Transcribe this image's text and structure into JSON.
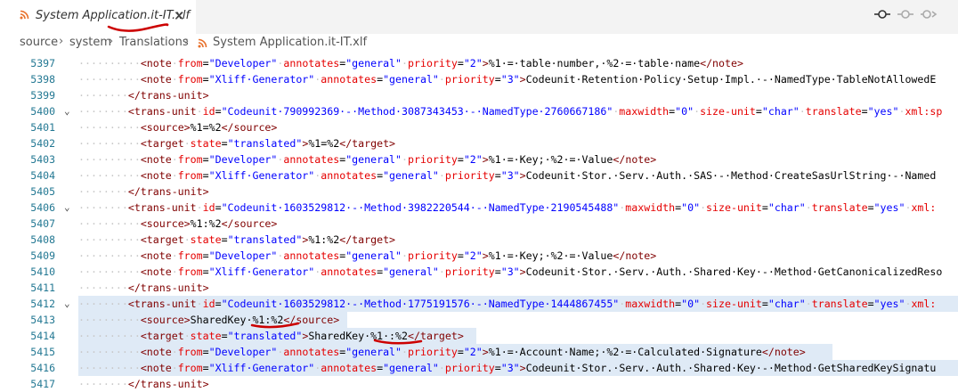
{
  "tab": {
    "title": "System Application.it-IT.xlf",
    "icon": "rss-icon",
    "close": "✕"
  },
  "breadcrumb": {
    "items": [
      "source",
      "system",
      "Translations",
      "System Application.it-IT.xlf"
    ],
    "separator": "›"
  },
  "editor_actions": {
    "icons": [
      "git-commit-icon",
      "git-compare-icon",
      "git-next-icon"
    ]
  },
  "colors": {
    "tag": "#800000",
    "attr": "#e50000",
    "value": "#0000ff",
    "line_number": "#237893",
    "selection": "#dfeaf6",
    "annotation": "#cc0000"
  },
  "lines": [
    {
      "n": "5397",
      "fold": "",
      "code": [
        [
          "ws",
          "··········"
        ],
        [
          "tg",
          "<note"
        ],
        [
          "ws",
          "·"
        ],
        [
          "at",
          "from"
        ],
        [
          "tx",
          "="
        ],
        [
          "av",
          "\"Developer\""
        ],
        [
          "ws",
          "·"
        ],
        [
          "at",
          "annotates"
        ],
        [
          "tx",
          "="
        ],
        [
          "av",
          "\"general\""
        ],
        [
          "ws",
          "·"
        ],
        [
          "at",
          "priority"
        ],
        [
          "tx",
          "="
        ],
        [
          "av",
          "\"2\""
        ],
        [
          "tg",
          ">"
        ],
        [
          "tx",
          "%1·=·table·number,·%2·=·table·name"
        ],
        [
          "tg",
          "</note>"
        ]
      ]
    },
    {
      "n": "5398",
      "fold": "",
      "code": [
        [
          "ws",
          "··········"
        ],
        [
          "tg",
          "<note"
        ],
        [
          "ws",
          "·"
        ],
        [
          "at",
          "from"
        ],
        [
          "tx",
          "="
        ],
        [
          "av",
          "\"Xliff·Generator\""
        ],
        [
          "ws",
          "·"
        ],
        [
          "at",
          "annotates"
        ],
        [
          "tx",
          "="
        ],
        [
          "av",
          "\"general\""
        ],
        [
          "ws",
          "·"
        ],
        [
          "at",
          "priority"
        ],
        [
          "tx",
          "="
        ],
        [
          "av",
          "\"3\""
        ],
        [
          "tg",
          ">"
        ],
        [
          "tx",
          "Codeunit·Retention·Policy·Setup·Impl.·-·NamedType·TableNotAllowedE"
        ]
      ]
    },
    {
      "n": "5399",
      "fold": "",
      "code": [
        [
          "ws",
          "········"
        ],
        [
          "tg",
          "</trans-unit>"
        ]
      ]
    },
    {
      "n": "5400",
      "fold": "⌄",
      "code": [
        [
          "ws",
          "········"
        ],
        [
          "tg",
          "<trans-unit"
        ],
        [
          "ws",
          "·"
        ],
        [
          "at",
          "id"
        ],
        [
          "tx",
          "="
        ],
        [
          "av",
          "\"Codeunit·790992369·-·Method·3087343453·-·NamedType·2760667186\""
        ],
        [
          "ws",
          "·"
        ],
        [
          "at",
          "maxwidth"
        ],
        [
          "tx",
          "="
        ],
        [
          "av",
          "\"0\""
        ],
        [
          "ws",
          "·"
        ],
        [
          "at",
          "size-unit"
        ],
        [
          "tx",
          "="
        ],
        [
          "av",
          "\"char\""
        ],
        [
          "ws",
          "·"
        ],
        [
          "at",
          "translate"
        ],
        [
          "tx",
          "="
        ],
        [
          "av",
          "\"yes\""
        ],
        [
          "ws",
          "·"
        ],
        [
          "at",
          "xml:sp"
        ]
      ]
    },
    {
      "n": "5401",
      "fold": "",
      "code": [
        [
          "ws",
          "··········"
        ],
        [
          "tg",
          "<source>"
        ],
        [
          "tx",
          "%1=%2"
        ],
        [
          "tg",
          "</source>"
        ]
      ]
    },
    {
      "n": "5402",
      "fold": "",
      "code": [
        [
          "ws",
          "··········"
        ],
        [
          "tg",
          "<target"
        ],
        [
          "ws",
          "·"
        ],
        [
          "at",
          "state"
        ],
        [
          "tx",
          "="
        ],
        [
          "av",
          "\"translated\""
        ],
        [
          "tg",
          ">"
        ],
        [
          "tx",
          "%1=%2"
        ],
        [
          "tg",
          "</target>"
        ]
      ]
    },
    {
      "n": "5403",
      "fold": "",
      "code": [
        [
          "ws",
          "··········"
        ],
        [
          "tg",
          "<note"
        ],
        [
          "ws",
          "·"
        ],
        [
          "at",
          "from"
        ],
        [
          "tx",
          "="
        ],
        [
          "av",
          "\"Developer\""
        ],
        [
          "ws",
          "·"
        ],
        [
          "at",
          "annotates"
        ],
        [
          "tx",
          "="
        ],
        [
          "av",
          "\"general\""
        ],
        [
          "ws",
          "·"
        ],
        [
          "at",
          "priority"
        ],
        [
          "tx",
          "="
        ],
        [
          "av",
          "\"2\""
        ],
        [
          "tg",
          ">"
        ],
        [
          "tx",
          "%1·=·Key;·%2·=·Value"
        ],
        [
          "tg",
          "</note>"
        ]
      ]
    },
    {
      "n": "5404",
      "fold": "",
      "code": [
        [
          "ws",
          "··········"
        ],
        [
          "tg",
          "<note"
        ],
        [
          "ws",
          "·"
        ],
        [
          "at",
          "from"
        ],
        [
          "tx",
          "="
        ],
        [
          "av",
          "\"Xliff·Generator\""
        ],
        [
          "ws",
          "·"
        ],
        [
          "at",
          "annotates"
        ],
        [
          "tx",
          "="
        ],
        [
          "av",
          "\"general\""
        ],
        [
          "ws",
          "·"
        ],
        [
          "at",
          "priority"
        ],
        [
          "tx",
          "="
        ],
        [
          "av",
          "\"3\""
        ],
        [
          "tg",
          ">"
        ],
        [
          "tx",
          "Codeunit·Stor.·Serv.·Auth.·SAS·-·Method·CreateSasUrlString·-·Named"
        ]
      ]
    },
    {
      "n": "5405",
      "fold": "",
      "code": [
        [
          "ws",
          "········"
        ],
        [
          "tg",
          "</trans-unit>"
        ]
      ]
    },
    {
      "n": "5406",
      "fold": "⌄",
      "code": [
        [
          "ws",
          "········"
        ],
        [
          "tg",
          "<trans-unit"
        ],
        [
          "ws",
          "·"
        ],
        [
          "at",
          "id"
        ],
        [
          "tx",
          "="
        ],
        [
          "av",
          "\"Codeunit·1603529812·-·Method·3982220544·-·NamedType·2190545488\""
        ],
        [
          "ws",
          "·"
        ],
        [
          "at",
          "maxwidth"
        ],
        [
          "tx",
          "="
        ],
        [
          "av",
          "\"0\""
        ],
        [
          "ws",
          "·"
        ],
        [
          "at",
          "size-unit"
        ],
        [
          "tx",
          "="
        ],
        [
          "av",
          "\"char\""
        ],
        [
          "ws",
          "·"
        ],
        [
          "at",
          "translate"
        ],
        [
          "tx",
          "="
        ],
        [
          "av",
          "\"yes\""
        ],
        [
          "ws",
          "·"
        ],
        [
          "at",
          "xml:"
        ]
      ]
    },
    {
      "n": "5407",
      "fold": "",
      "code": [
        [
          "ws",
          "··········"
        ],
        [
          "tg",
          "<source>"
        ],
        [
          "tx",
          "%1:%2"
        ],
        [
          "tg",
          "</source>"
        ]
      ]
    },
    {
      "n": "5408",
      "fold": "",
      "code": [
        [
          "ws",
          "··········"
        ],
        [
          "tg",
          "<target"
        ],
        [
          "ws",
          "·"
        ],
        [
          "at",
          "state"
        ],
        [
          "tx",
          "="
        ],
        [
          "av",
          "\"translated\""
        ],
        [
          "tg",
          ">"
        ],
        [
          "tx",
          "%1:%2"
        ],
        [
          "tg",
          "</target>"
        ]
      ]
    },
    {
      "n": "5409",
      "fold": "",
      "code": [
        [
          "ws",
          "··········"
        ],
        [
          "tg",
          "<note"
        ],
        [
          "ws",
          "·"
        ],
        [
          "at",
          "from"
        ],
        [
          "tx",
          "="
        ],
        [
          "av",
          "\"Developer\""
        ],
        [
          "ws",
          "·"
        ],
        [
          "at",
          "annotates"
        ],
        [
          "tx",
          "="
        ],
        [
          "av",
          "\"general\""
        ],
        [
          "ws",
          "·"
        ],
        [
          "at",
          "priority"
        ],
        [
          "tx",
          "="
        ],
        [
          "av",
          "\"2\""
        ],
        [
          "tg",
          ">"
        ],
        [
          "tx",
          "%1·=·Key;·%2·=·Value"
        ],
        [
          "tg",
          "</note>"
        ]
      ]
    },
    {
      "n": "5410",
      "fold": "",
      "code": [
        [
          "ws",
          "··········"
        ],
        [
          "tg",
          "<note"
        ],
        [
          "ws",
          "·"
        ],
        [
          "at",
          "from"
        ],
        [
          "tx",
          "="
        ],
        [
          "av",
          "\"Xliff·Generator\""
        ],
        [
          "ws",
          "·"
        ],
        [
          "at",
          "annotates"
        ],
        [
          "tx",
          "="
        ],
        [
          "av",
          "\"general\""
        ],
        [
          "ws",
          "·"
        ],
        [
          "at",
          "priority"
        ],
        [
          "tx",
          "="
        ],
        [
          "av",
          "\"3\""
        ],
        [
          "tg",
          ">"
        ],
        [
          "tx",
          "Codeunit·Stor.·Serv.·Auth.·Shared·Key·-·Method·GetCanonicalizedReso"
        ]
      ]
    },
    {
      "n": "5411",
      "fold": "",
      "code": [
        [
          "ws",
          "········"
        ],
        [
          "tg",
          "</trans-unit>"
        ]
      ]
    },
    {
      "n": "5412",
      "fold": "⌄",
      "selected": 1076,
      "code": [
        [
          "ws",
          "········"
        ],
        [
          "tg",
          "<trans-unit"
        ],
        [
          "ws",
          "·"
        ],
        [
          "at",
          "id"
        ],
        [
          "tx",
          "="
        ],
        [
          "av",
          "\"Codeunit·1603529812·-·Method·1775191576·-·NamedType·1444867455\""
        ],
        [
          "ws",
          "·"
        ],
        [
          "at",
          "maxwidth"
        ],
        [
          "tx",
          "="
        ],
        [
          "av",
          "\"0\""
        ],
        [
          "ws",
          "·"
        ],
        [
          "at",
          "size-unit"
        ],
        [
          "tx",
          "="
        ],
        [
          "av",
          "\"char\""
        ],
        [
          "ws",
          "·"
        ],
        [
          "at",
          "translate"
        ],
        [
          "tx",
          "="
        ],
        [
          "av",
          "\"yes\""
        ],
        [
          "ws",
          "·"
        ],
        [
          "at",
          "xml:"
        ]
      ]
    },
    {
      "n": "5413",
      "fold": "",
      "selected": 390,
      "code": [
        [
          "ws",
          "··········"
        ],
        [
          "tg",
          "<source>"
        ],
        [
          "tx",
          "SharedKey·%1:%2"
        ],
        [
          "tg",
          "</source>"
        ]
      ]
    },
    {
      "n": "5414",
      "fold": "",
      "selected": 535,
      "code": [
        [
          "ws",
          "··········"
        ],
        [
          "tg",
          "<target"
        ],
        [
          "ws",
          "·"
        ],
        [
          "at",
          "state"
        ],
        [
          "tx",
          "="
        ],
        [
          "av",
          "\"translated\""
        ],
        [
          "tg",
          ">"
        ],
        [
          "tx",
          "SharedKey·%1·:%2"
        ],
        [
          "tg",
          "</target>"
        ]
      ]
    },
    {
      "n": "5415",
      "fold": "",
      "selected": 935,
      "code": [
        [
          "ws",
          "··········"
        ],
        [
          "tg",
          "<note"
        ],
        [
          "ws",
          "·"
        ],
        [
          "at",
          "from"
        ],
        [
          "tx",
          "="
        ],
        [
          "av",
          "\"Developer\""
        ],
        [
          "ws",
          "·"
        ],
        [
          "at",
          "annotates"
        ],
        [
          "tx",
          "="
        ],
        [
          "av",
          "\"general\""
        ],
        [
          "ws",
          "·"
        ],
        [
          "at",
          "priority"
        ],
        [
          "tx",
          "="
        ],
        [
          "av",
          "\"2\""
        ],
        [
          "tg",
          ">"
        ],
        [
          "tx",
          "%1·=·Account·Name;·%2·=·Calculated·Signature"
        ],
        [
          "tg",
          "</note>"
        ]
      ]
    },
    {
      "n": "5416",
      "fold": "",
      "selected": 1076,
      "code": [
        [
          "ws",
          "··········"
        ],
        [
          "tg",
          "<note"
        ],
        [
          "ws",
          "·"
        ],
        [
          "at",
          "from"
        ],
        [
          "tx",
          "="
        ],
        [
          "av",
          "\"Xliff·Generator\""
        ],
        [
          "ws",
          "·"
        ],
        [
          "at",
          "annotates"
        ],
        [
          "tx",
          "="
        ],
        [
          "av",
          "\"general\""
        ],
        [
          "ws",
          "·"
        ],
        [
          "at",
          "priority"
        ],
        [
          "tx",
          "="
        ],
        [
          "av",
          "\"3\""
        ],
        [
          "tg",
          ">"
        ],
        [
          "tx",
          "Codeunit·Stor.·Serv.·Auth.·Shared·Key·-·Method·GetSharedKeySignatu"
        ]
      ]
    },
    {
      "n": "5417",
      "fold": "",
      "code": [
        [
          "ws",
          "········"
        ],
        [
          "tg",
          "</trans-unit>"
        ]
      ]
    }
  ]
}
